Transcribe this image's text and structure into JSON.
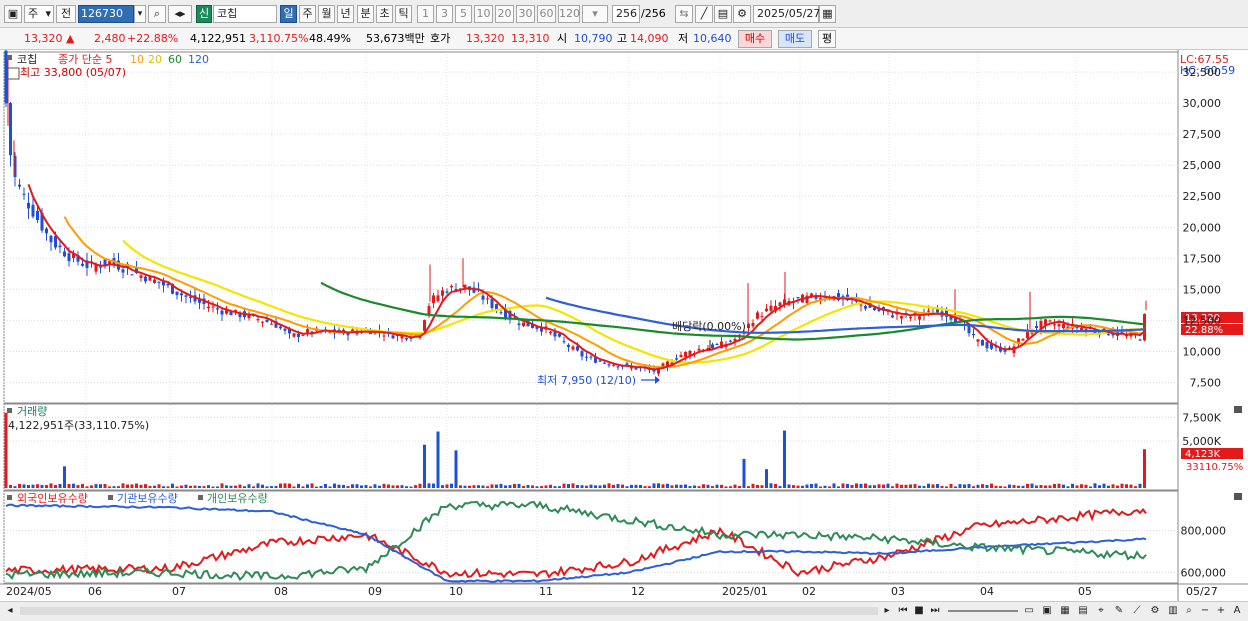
{
  "toolbar": {
    "mode": "주",
    "prefix": "전",
    "code": "126730",
    "badge": "신",
    "stock_name": "코칩",
    "periods": [
      "일",
      "주",
      "월",
      "년",
      "분",
      "초",
      "틱"
    ],
    "active_period": "일",
    "intervals": [
      "1",
      "3",
      "5",
      "10",
      "20",
      "30",
      "60",
      "120"
    ],
    "count": "256",
    "count_total": "/256",
    "date": "2025/05/27"
  },
  "quote": {
    "price": "13,320",
    "change_arrow": "▲",
    "change": "2,480",
    "change_pct": "+22.88%",
    "volume": "4,122,951",
    "volume_ratio": "3,110.75%",
    "turnover": "48.49%",
    "amount": "53,673백만",
    "hoga_label": "호가",
    "ask": "13,320",
    "bid": "13,310",
    "open_label": "시",
    "open": "10,790",
    "high_label": "고",
    "high": "14,090",
    "low_label": "저",
    "low": "10,640",
    "buy_label": "매수",
    "sell_label": "매도",
    "eval_label": "평"
  },
  "price_panel": {
    "stock_label": "코칩",
    "ma_label": "종가 단순 5",
    "ma_periods": [
      "10",
      "20",
      "60",
      "120"
    ],
    "ma_colors": {
      "5": "#e31a1c",
      "10": "#ff9c00",
      "20": "#f2e600",
      "60": "#1a8a2a",
      "120": "#2c5fd8"
    },
    "high_note": "최고 33,800 (05/07)",
    "low_note": "최저 7,950 (12/10)",
    "dividend_note": "배당락(0.00%)",
    "lc": "LC:67.55",
    "hc": "HC:-60.59",
    "last_price_tag": "13,320",
    "last_pct_tag": "22.88%",
    "y_ticks": [
      "32,500",
      "30,000",
      "27,500",
      "25,000",
      "22,500",
      "20,000",
      "17,500",
      "15,000",
      "12,500",
      "10,000",
      "7,500"
    ]
  },
  "volume_panel": {
    "title": "거래량",
    "info": "4,122,951주(33,110.75%)",
    "y_ticks": [
      "7,500K",
      "5,000K"
    ],
    "last_tag": "4,123K",
    "last_pct": "33110.75%"
  },
  "holding_panel": {
    "labels": [
      "외국인보유수량",
      "기관보유수량",
      "개인보유수량"
    ],
    "y_ticks": [
      "800,000",
      "600,000"
    ]
  },
  "x_axis": [
    "2024/05",
    "06",
    "07",
    "08",
    "09",
    "10",
    "11",
    "12",
    "2025/01",
    "02",
    "03",
    "04",
    "05"
  ],
  "x_axis_right": "05/27",
  "colors": {
    "up": "#e31a1c",
    "down": "#1f4fd8",
    "foreign": "#e31a1c",
    "institution": "#2c5fd8",
    "individual": "#2e8b57",
    "accent": "#2f6db5"
  },
  "chart_data": [
    {
      "type": "line",
      "title": "코칩",
      "series": [
        {
          "name": "5",
          "x": [
            "2024/05",
            "06",
            "07",
            "08",
            "09",
            "10",
            "11",
            "12",
            "2025/01",
            "02",
            "03",
            "04",
            "05/27"
          ],
          "values": [
            30000,
            17200,
            14800,
            11500,
            11200,
            15000,
            12000,
            8600,
            10800,
            14800,
            12400,
            10000,
            13320
          ]
        },
        {
          "name": "120",
          "x": [
            "2024/11",
            "12",
            "2025/01",
            "02",
            "03",
            "04",
            "05/27"
          ],
          "values": [
            14600,
            12800,
            12000,
            12000,
            12000,
            11800,
            11600
          ]
        }
      ],
      "ylim": [
        6000,
        33800
      ],
      "annotations": [
        "최고 33,800 (05/07)",
        "최저 7,950 (12/10)",
        "배당락(0.00%)"
      ]
    },
    {
      "type": "bar",
      "title": "거래량",
      "categories": [
        "09",
        "10",
        "01",
        "02",
        "05/27"
      ],
      "values": [
        6200000,
        6000000,
        3100000,
        6200000,
        4122951
      ]
    },
    {
      "type": "line",
      "series": [
        {
          "name": "외국인보유수량",
          "x": [
            "2024/05",
            "07",
            "08",
            "09",
            "10",
            "11",
            "12",
            "2025/01",
            "02",
            "03",
            "04",
            "05/27"
          ],
          "values": [
            610000,
            620000,
            740000,
            780000,
            600000,
            590000,
            650000,
            800000,
            600000,
            680000,
            820000,
            900000
          ]
        },
        {
          "name": "기관보유수량",
          "x": [
            "2024/05",
            "07",
            "08",
            "09",
            "10",
            "11",
            "12",
            "2025/01",
            "02",
            "03",
            "04",
            "05/27"
          ],
          "values": [
            920000,
            910000,
            890000,
            780000,
            560000,
            560000,
            600000,
            700000,
            700000,
            690000,
            720000,
            760000
          ]
        },
        {
          "name": "개인보유수량",
          "x": [
            "2024/05",
            "07",
            "08",
            "09",
            "10",
            "11",
            "12",
            "2025/01",
            "02",
            "03",
            "04",
            "05/27"
          ],
          "values": [
            590000,
            600000,
            580000,
            620000,
            920000,
            920000,
            850000,
            780000,
            780000,
            760000,
            720000,
            680000
          ]
        }
      ],
      "ylim": [
        560000,
        950000
      ]
    }
  ]
}
